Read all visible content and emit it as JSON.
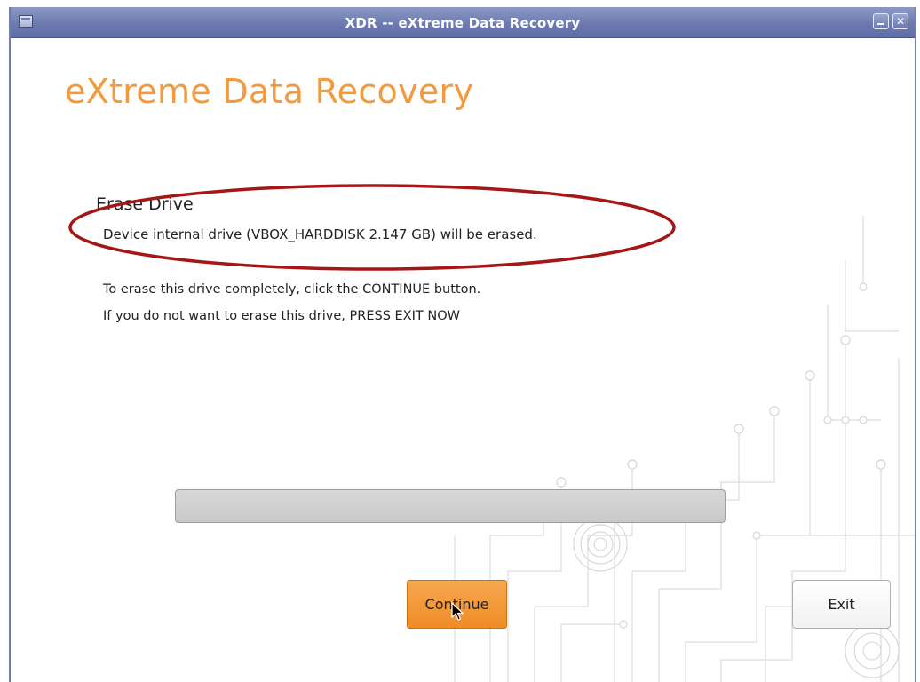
{
  "window": {
    "title": "XDR -- eXtreme Data Recovery"
  },
  "app": {
    "heading": "eXtreme Data Recovery"
  },
  "erase": {
    "section_title": "Erase Drive",
    "device_message": "Device internal drive (VBOX_HARDDISK 2.147 GB) will be erased.",
    "instruction_1": "To erase this drive completely, click the CONTINUE button.",
    "instruction_2": "If you do not want to erase this drive, PRESS EXIT NOW"
  },
  "progress": {
    "value": 0
  },
  "buttons": {
    "continue_label": "Continue",
    "exit_label": "Exit"
  },
  "icons": {
    "window_menu": "window-menu-icon",
    "minimize": "minimize-icon",
    "close": "close-icon",
    "cursor": "mouse-pointer-icon"
  },
  "colors": {
    "accent_orange": "#f29a3e",
    "titlebar_blue": "#6d7bb1",
    "annotation_red": "#a51717"
  }
}
